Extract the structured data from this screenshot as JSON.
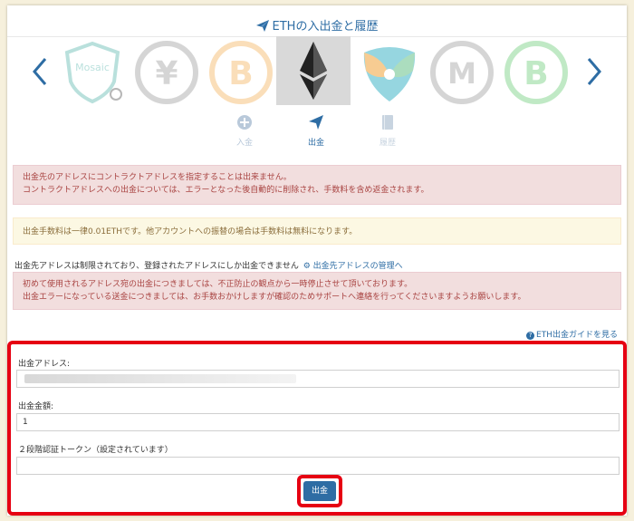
{
  "header": {
    "title": "ETHの入出金と履歴",
    "accent_color": "#2e6da4"
  },
  "carousel": {
    "prev_icon": "chevron-left-icon",
    "next_icon": "chevron-right-icon",
    "coins": [
      {
        "name": "mosaic",
        "label": "Mosaic",
        "color": "#3aa89e"
      },
      {
        "name": "jpy",
        "label": "¥",
        "color": "#8a8a8a"
      },
      {
        "name": "btc",
        "label": "B",
        "color": "#f2a33a"
      },
      {
        "name": "eth",
        "label": "",
        "color": "#222222",
        "selected": true
      },
      {
        "name": "xem",
        "label": "",
        "color": "#41b6c8"
      },
      {
        "name": "mona",
        "label": "M",
        "color": "#8a8a8a"
      },
      {
        "name": "bch",
        "label": "B",
        "color": "#4cc35b"
      }
    ]
  },
  "actions": {
    "deposit": "入金",
    "withdraw": "出金",
    "history": "履歴"
  },
  "alerts": {
    "contract_line1": "出金先のアドレスにコントラクトアドレスを指定することは出来ません。",
    "contract_line2": "コントラクトアドレスへの出金については、エラーとなった後自動的に削除され、手数料を含め返金されます。",
    "fee": "出金手数料は一律0.01ETHです。他アカウントへの振替の場合は手数料は無料になります。",
    "limit_text": "出金先アドレスは制限されており、登録されたアドレスにしか出金できません",
    "manage_link": "出金先アドレスの管理へ",
    "suspend_line1": "初めて使用されるアドレス宛の出金につきましては、不正防止の観点から一時停止させて頂いております。",
    "suspend_line2": "出金エラーになっている送金につきましては、お手数おかけしますが確認のためサポートへ連絡を行ってくださいますようお願いします。"
  },
  "guide_link": "ETH出金ガイドを見る",
  "form": {
    "address_label": "出金アドレス:",
    "address_value": "",
    "amount_label": "出金金額:",
    "amount_value": "1",
    "token_label": "２段階認証トークン（設定されています）",
    "token_value": "",
    "submit_label": "出金",
    "highlight_color": "#e60012"
  }
}
